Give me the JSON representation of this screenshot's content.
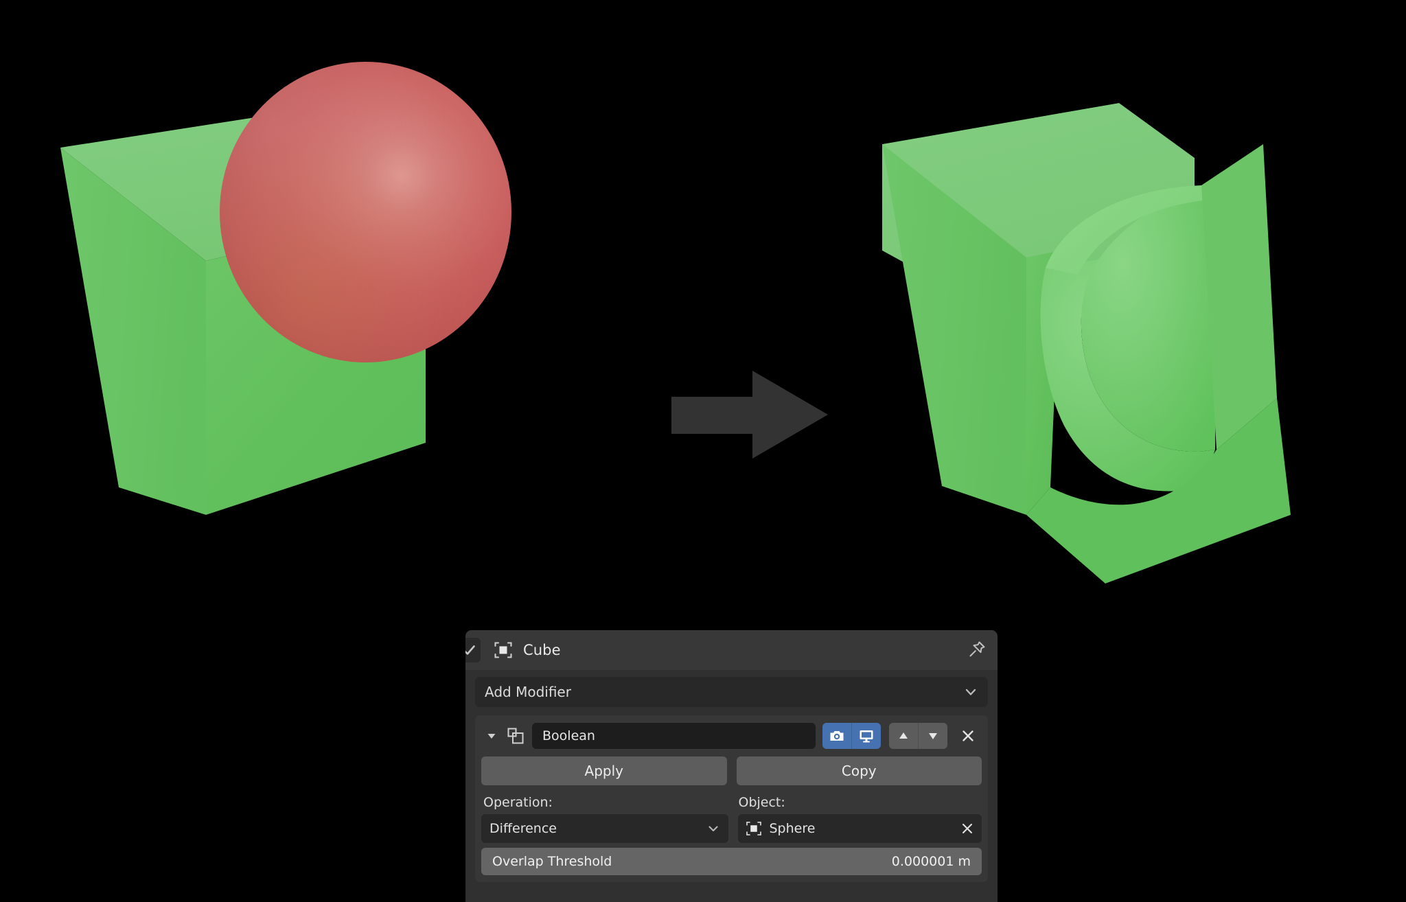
{
  "viewport": {
    "background": "#000000",
    "arrow": {
      "icon": "arrow-right-icon",
      "color": "#333333"
    },
    "before": {
      "label": "cube-with-intersecting-sphere",
      "cube": {
        "name": "Cube",
        "color_top": "#7bc97b",
        "color_front": "#63c05d",
        "color_side": "#6ec869"
      },
      "sphere": {
        "name": "Sphere",
        "color": "#c85f5e"
      }
    },
    "after": {
      "label": "cube-with-spherical-cavity",
      "cube": {
        "name": "Cube",
        "color_top": "#7bc97b",
        "color_front": "#63c05d",
        "color_cavity": "#74cc70"
      }
    }
  },
  "panel": {
    "header": {
      "checkbox_icon": "check-icon",
      "object_icon": "object-data-icon",
      "title": "Cube",
      "pin_icon": "pin-icon"
    },
    "add_modifier": {
      "label": "Add Modifier",
      "chevron_icon": "chevron-down-icon"
    },
    "modifier": {
      "expand_icon": "triangle-down-icon",
      "type_icon": "boolean-modifier-icon",
      "name": "Boolean",
      "toggles": [
        {
          "name": "render-visibility-toggle",
          "icon": "camera-icon",
          "active": true,
          "color": "#4772b2"
        },
        {
          "name": "viewport-visibility-toggle",
          "icon": "monitor-icon",
          "active": true,
          "color": "#4772b2"
        }
      ],
      "move_up_icon": "triangle-up-icon",
      "move_down_icon": "triangle-down-icon",
      "close_icon": "x-icon",
      "apply_label": "Apply",
      "copy_label": "Copy",
      "operation_label": "Operation:",
      "operation_value": "Difference",
      "operation_chevron_icon": "chevron-down-icon",
      "object_label": "Object:",
      "object_icon": "object-data-icon",
      "object_value": "Sphere",
      "object_clear_icon": "x-icon",
      "overlap_threshold_label": "Overlap Threshold",
      "overlap_threshold_value": "0.000001 m"
    }
  }
}
